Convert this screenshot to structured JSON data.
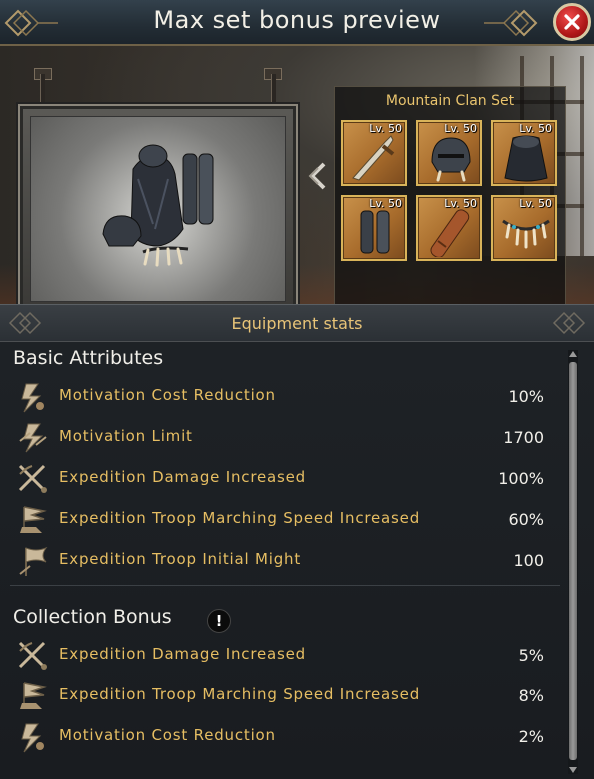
{
  "header": {
    "title": "Max set bonus preview"
  },
  "set": {
    "name": "Mountain Clan Set",
    "items": [
      {
        "level": "Lv. 50",
        "icon": "dagger-icon"
      },
      {
        "level": "Lv. 50",
        "icon": "helmet-icon"
      },
      {
        "level": "Lv. 50",
        "icon": "cape-icon"
      },
      {
        "level": "Lv. 50",
        "icon": "greaves-icon"
      },
      {
        "level": "Lv. 50",
        "icon": "scroll-case-icon"
      },
      {
        "level": "Lv. 50",
        "icon": "claw-necklace-icon"
      }
    ]
  },
  "stats": {
    "header": "Equipment stats",
    "basic": {
      "title": "Basic Attributes",
      "rows": [
        {
          "name": "Motivation Cost Reduction",
          "value": "10%",
          "icon": "motivation-cost-icon"
        },
        {
          "name": "Motivation Limit",
          "value": "1700",
          "icon": "motivation-limit-icon"
        },
        {
          "name": "Expedition Damage Increased",
          "value": "100%",
          "icon": "crossed-swords-icon"
        },
        {
          "name": "Expedition Troop Marching Speed Increased",
          "value": "60%",
          "icon": "boot-flag-icon"
        },
        {
          "name": "Expedition Troop Initial Might",
          "value": "100",
          "icon": "banner-icon"
        }
      ]
    },
    "collection": {
      "title": "Collection Bonus",
      "info": "!",
      "rows": [
        {
          "name": "Expedition Damage Increased",
          "value": "5%",
          "icon": "crossed-swords-icon"
        },
        {
          "name": "Expedition Troop Marching Speed Increased",
          "value": "8%",
          "icon": "boot-flag-icon"
        },
        {
          "name": "Motivation Cost Reduction",
          "value": "2%",
          "icon": "motivation-cost-icon"
        }
      ]
    }
  },
  "colors": {
    "gold": "#e6be63",
    "close": "#c42020",
    "slot": "#b27434"
  }
}
